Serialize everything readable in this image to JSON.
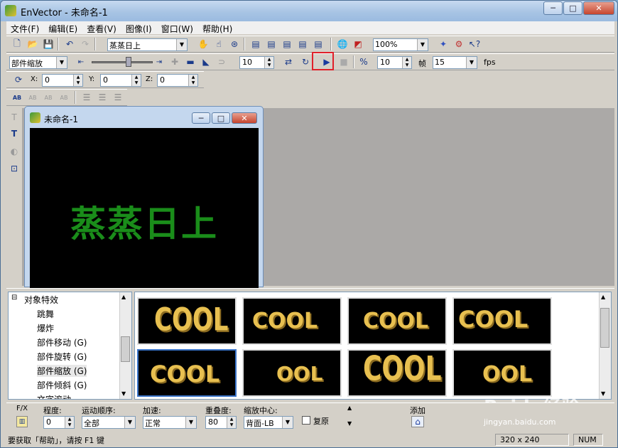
{
  "window": {
    "title": "EnVector - 未命名-1",
    "min": "─",
    "max": "□",
    "close": "✕"
  },
  "menu": [
    "文件(F)",
    "编辑(E)",
    "查看(V)",
    "图像(I)",
    "窗口(W)",
    "帮助(H)"
  ],
  "toolbar1": {
    "text_value": "蒸蒸日上",
    "zoom_value": "100%"
  },
  "toolbar2": {
    "effect_mode": "部件缩放",
    "frames": "10",
    "speed": "10",
    "frame_label": "帧",
    "fps_value": "15",
    "fps_label": "fps"
  },
  "toolbar3": {
    "x_label": "X:",
    "x_value": "0",
    "y_label": "Y:",
    "y_value": "0",
    "z_label": "Z:",
    "z_value": "0"
  },
  "toolbar4": {
    "b1": "AB",
    "b2": "AB",
    "b3": "AB",
    "b4": "AB"
  },
  "child_window": {
    "title": "未命名-1",
    "canvas_text": "蒸蒸日上"
  },
  "tree": {
    "root": "对象特效",
    "items": [
      "跳舞",
      "爆炸",
      "部件移动 (G)",
      "部件旋转 (G)",
      "部件缩放 (G)",
      "部件倾斜 (G)",
      "文字滚动"
    ]
  },
  "gallery": {
    "thumbs": [
      "COOL",
      "COOL",
      "COOL",
      "COOL",
      "COOL",
      "OOL",
      "COOL",
      "OOL"
    ]
  },
  "props": {
    "fx_label": "F/X",
    "degree_label": "程度:",
    "degree_value": "0",
    "order_label": "运动顺序:",
    "order_value": "全部",
    "accel_label": "加速:",
    "accel_value": "正常",
    "overlap_label": "重叠度:",
    "overlap_value": "80",
    "center_label": "缩放中心:",
    "center_value": "背面-LB",
    "restore_label": "复原",
    "add_label": "添加"
  },
  "status": {
    "help": "要获取「帮助」，请按 F1 键",
    "size": "320 x 240",
    "num": "NUM"
  },
  "watermark": {
    "text": "Baidu经验",
    "sub": "jingyan.baidu.com"
  },
  "colors": {
    "canvas_text": "#1a8d1a",
    "highlight": "#e0202a",
    "cool_text": "#e8c050"
  }
}
